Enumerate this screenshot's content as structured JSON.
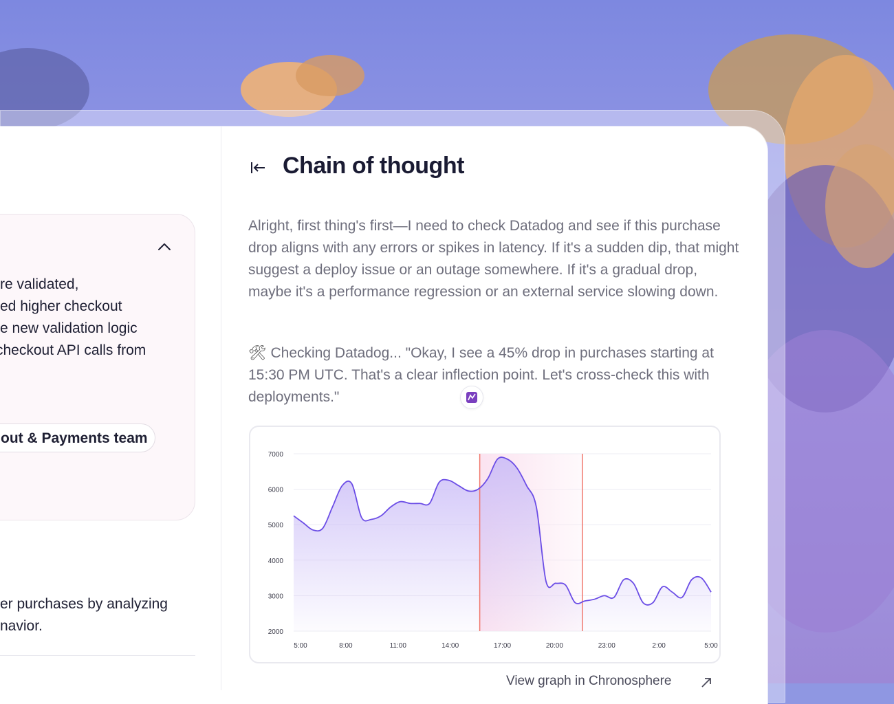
{
  "left_panel": {
    "lines": [
      "re validated,",
      "ed higher checkout",
      "e new validation logic",
      " checkout API calls from"
    ],
    "team_pill": "out & Payments team",
    "bottom_lines": [
      "er purchases by analyzing",
      "navior."
    ]
  },
  "panel": {
    "title": "Chain of thought",
    "paragraph1": "Alright, first thing's first—I need to check Datadog and see if this purchase drop aligns with any errors or spikes in latency. If it's a sudden dip, that might suggest a deploy issue or an outage somewhere. If it's a gradual drop, maybe it's a performance regression or an external service slowing down.",
    "tool_glyph": "🛠",
    "paragraph2": "Checking Datadog... \"Okay, I see a 45% drop in purchases starting at 15:30 PM UTC. That's a clear inflection point. Let's cross-check this with deployments.\"",
    "link_label": "View graph in Chronosphere"
  },
  "icons": {
    "collapse": "collapse-left-icon",
    "chevron": "chevron-up-icon",
    "tool_badge": "datadog-icon",
    "external": "external-link-icon"
  },
  "chart_data": {
    "type": "line",
    "title": "",
    "xlabel": "",
    "ylabel": "",
    "ylim": [
      2000,
      7000
    ],
    "yticks": [
      "7000",
      "6000",
      "5000",
      "4000",
      "3000",
      "2000"
    ],
    "xticks": [
      "5:00",
      "8:00",
      "11:00",
      "14:00",
      "17:00",
      "20:00",
      "23:00",
      "2:00",
      "5:00"
    ],
    "x_hours": [
      5,
      5.5,
      6,
      6.5,
      7,
      7.5,
      8,
      8.3,
      8.6,
      9,
      9.5,
      10,
      10.5,
      11,
      11.5,
      12,
      12.5,
      13,
      13.5,
      14,
      14.5,
      15,
      15.5,
      16,
      16.5,
      17,
      17.5,
      18,
      18.5,
      19,
      19.5,
      20,
      20.5,
      21,
      21.5,
      22,
      22.5,
      23,
      23.5,
      24,
      24.5,
      25,
      25.5,
      26,
      26.5,
      27,
      27.5,
      28,
      28.5,
      29
    ],
    "values": [
      5250,
      5050,
      4850,
      4900,
      5500,
      6100,
      6150,
      5200,
      5150,
      5250,
      5500,
      5650,
      5600,
      5600,
      5600,
      6200,
      6250,
      6100,
      5950,
      6000,
      6300,
      6850,
      6850,
      6600,
      6100,
      5500,
      3400,
      3350,
      3300,
      2800,
      2850,
      2900,
      3000,
      2950,
      3450,
      3350,
      2800,
      2800,
      3250,
      3100,
      2950,
      3450,
      3500,
      3100
    ],
    "markers_hours": [
      15.7,
      21.6
    ],
    "highlight_hours": [
      15.7,
      21.6
    ],
    "colors": {
      "line": "#6b4de6",
      "marker": "#f0766c",
      "fill": "#cbbdf7",
      "highlight": "#fbe3f0"
    }
  }
}
